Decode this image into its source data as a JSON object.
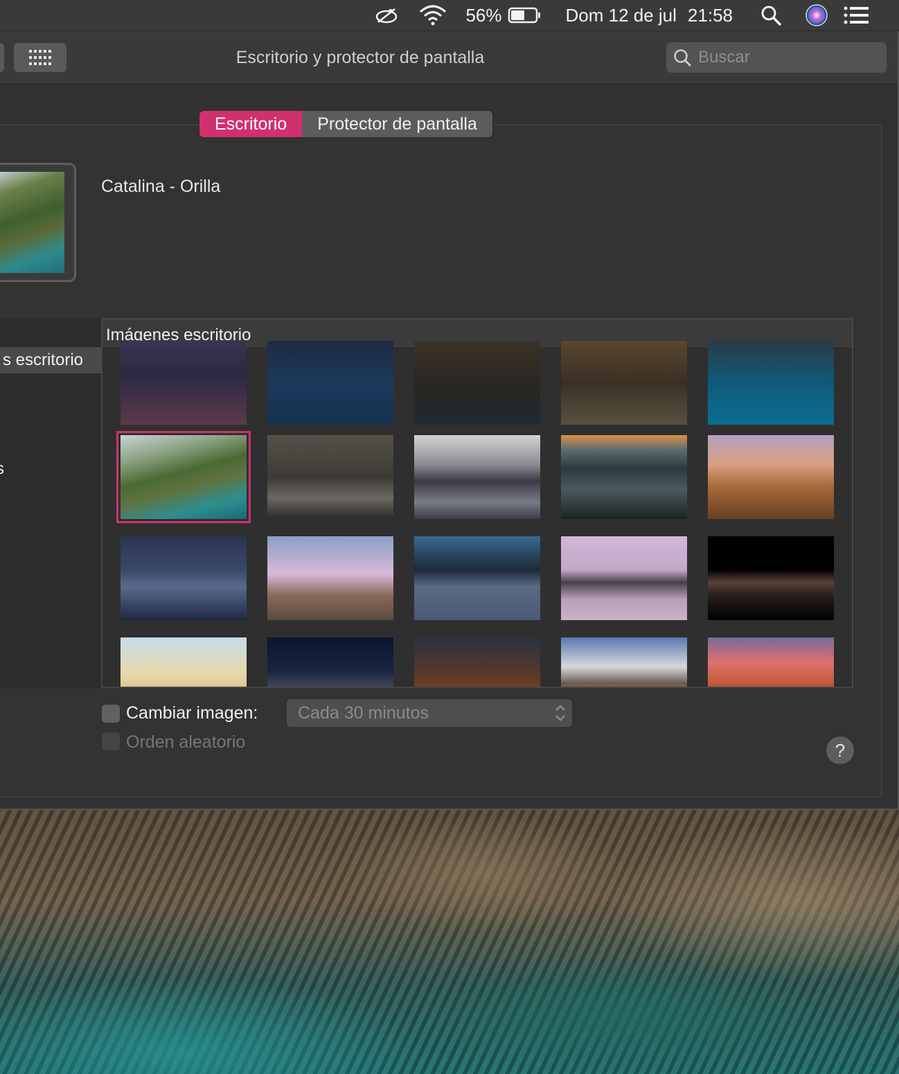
{
  "menubar": {
    "battery_percent": "56%",
    "date": "Dom 12 de jul",
    "time": "21:58",
    "battery_level": 0.56
  },
  "window": {
    "title": "Escritorio y protector de pantalla",
    "search_placeholder": "Buscar"
  },
  "tabs": [
    {
      "label": "Escritorio",
      "active": true
    },
    {
      "label": "Protector de pantalla",
      "active": false
    }
  ],
  "current_wallpaper": {
    "name": "Catalina - Orilla"
  },
  "sidebar": {
    "selected_item": "s escritorio",
    "partial_item": "s"
  },
  "grid": {
    "header": "Imágenes escritorio",
    "selected_index": 5,
    "thumbnail_count": 20
  },
  "controls": {
    "change_picture_label": "Cambiar imagen:",
    "change_picture_checked": false,
    "interval_value": "Cada 30 minutos",
    "random_order_label": "Orden aleatorio",
    "random_order_enabled": false,
    "help_label": "?"
  },
  "colors": {
    "accent": "#d1306e",
    "window_bg": "#323232",
    "menubar_bg": "#3a3a3a"
  }
}
